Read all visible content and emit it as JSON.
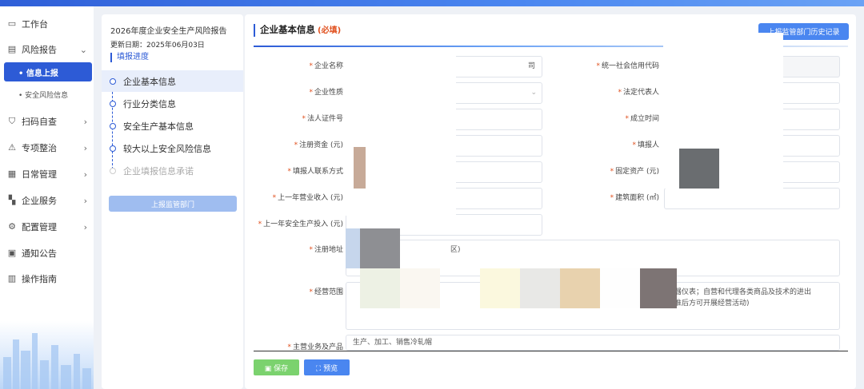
{
  "sidebar": {
    "items": [
      {
        "label": "工作台",
        "icon": "monitor-icon",
        "has_arrow": false
      },
      {
        "label": "风险报告",
        "icon": "document-icon",
        "has_arrow": true,
        "expanded": true
      },
      {
        "label": "扫码自查",
        "icon": "shield-icon",
        "has_arrow": true
      },
      {
        "label": "专项整治",
        "icon": "warning-icon",
        "has_arrow": true
      },
      {
        "label": "日常管理",
        "icon": "calendar-icon",
        "has_arrow": true
      },
      {
        "label": "企业服务",
        "icon": "grid-icon",
        "has_arrow": true
      },
      {
        "label": "配置管理",
        "icon": "gear-icon",
        "has_arrow": true
      },
      {
        "label": "通知公告",
        "icon": "notice-icon",
        "has_arrow": false
      },
      {
        "label": "操作指南",
        "icon": "book-icon",
        "has_arrow": false
      }
    ],
    "sub_items": [
      {
        "label": "• 信息上报",
        "active": true
      },
      {
        "label": "• 安全风险信息",
        "active": false
      }
    ]
  },
  "progress": {
    "report_title": "2026年度企业安全生产风险报告",
    "update_date": "更新日期：2025年06月03日",
    "section_title": "填报进度",
    "steps": [
      {
        "label": "企业基本信息",
        "state": "active"
      },
      {
        "label": "行业分类信息",
        "state": "normal"
      },
      {
        "label": "安全生产基本信息",
        "state": "normal"
      },
      {
        "label": "较大以上安全风险信息",
        "state": "normal"
      },
      {
        "label": "企业填报信息承诺",
        "state": "disabled"
      }
    ],
    "submit_label": "上报监管部门"
  },
  "form": {
    "title": "企业基本信息",
    "required_tag": "(必填)",
    "history_label": "上报监管部门历史记录",
    "fields": {
      "company_name": {
        "label": "企业名称",
        "value": "司"
      },
      "credit_code": {
        "label": "统一社会信用代码",
        "value": ""
      },
      "company_type": {
        "label": "企业性质",
        "value": ""
      },
      "legal_rep": {
        "label": "法定代表人",
        "value": ""
      },
      "legal_id": {
        "label": "法人证件号",
        "value": ""
      },
      "established": {
        "label": "成立时间",
        "value": ""
      },
      "reg_capital": {
        "label": "注册资金 (元)",
        "value": ""
      },
      "filler": {
        "label": "填报人",
        "value": ""
      },
      "filler_contact": {
        "label": "填报人联系方式",
        "value": ""
      },
      "fixed_assets": {
        "label": "固定资产 (元)",
        "value": ""
      },
      "last_revenue": {
        "label": "上一年营业收入 (元)",
        "value": ""
      },
      "building_area": {
        "label": "建筑面积 (㎡)",
        "value": ""
      },
      "last_safety_invest": {
        "label": "上一年安全生产投入 (元)",
        "value": ""
      },
      "reg_address": {
        "label": "注册地址",
        "value": "区)"
      },
      "business_scope": {
        "label": "经营范围",
        "value_line1": "、仪器仪表；自营和代理各类商品及技术的进出",
        "value_line2": "门批准后方可开展经营活动)"
      },
      "main_business": {
        "label": "主营业务及产品",
        "value": "生产、加工、销售冷轧帽"
      }
    },
    "save_label": "保存",
    "preview_label": "预览"
  },
  "colors": {
    "accent": "#2d5bd6",
    "required": "#e0501e",
    "save": "#7bd26e",
    "primary_button": "#4a86f0"
  }
}
